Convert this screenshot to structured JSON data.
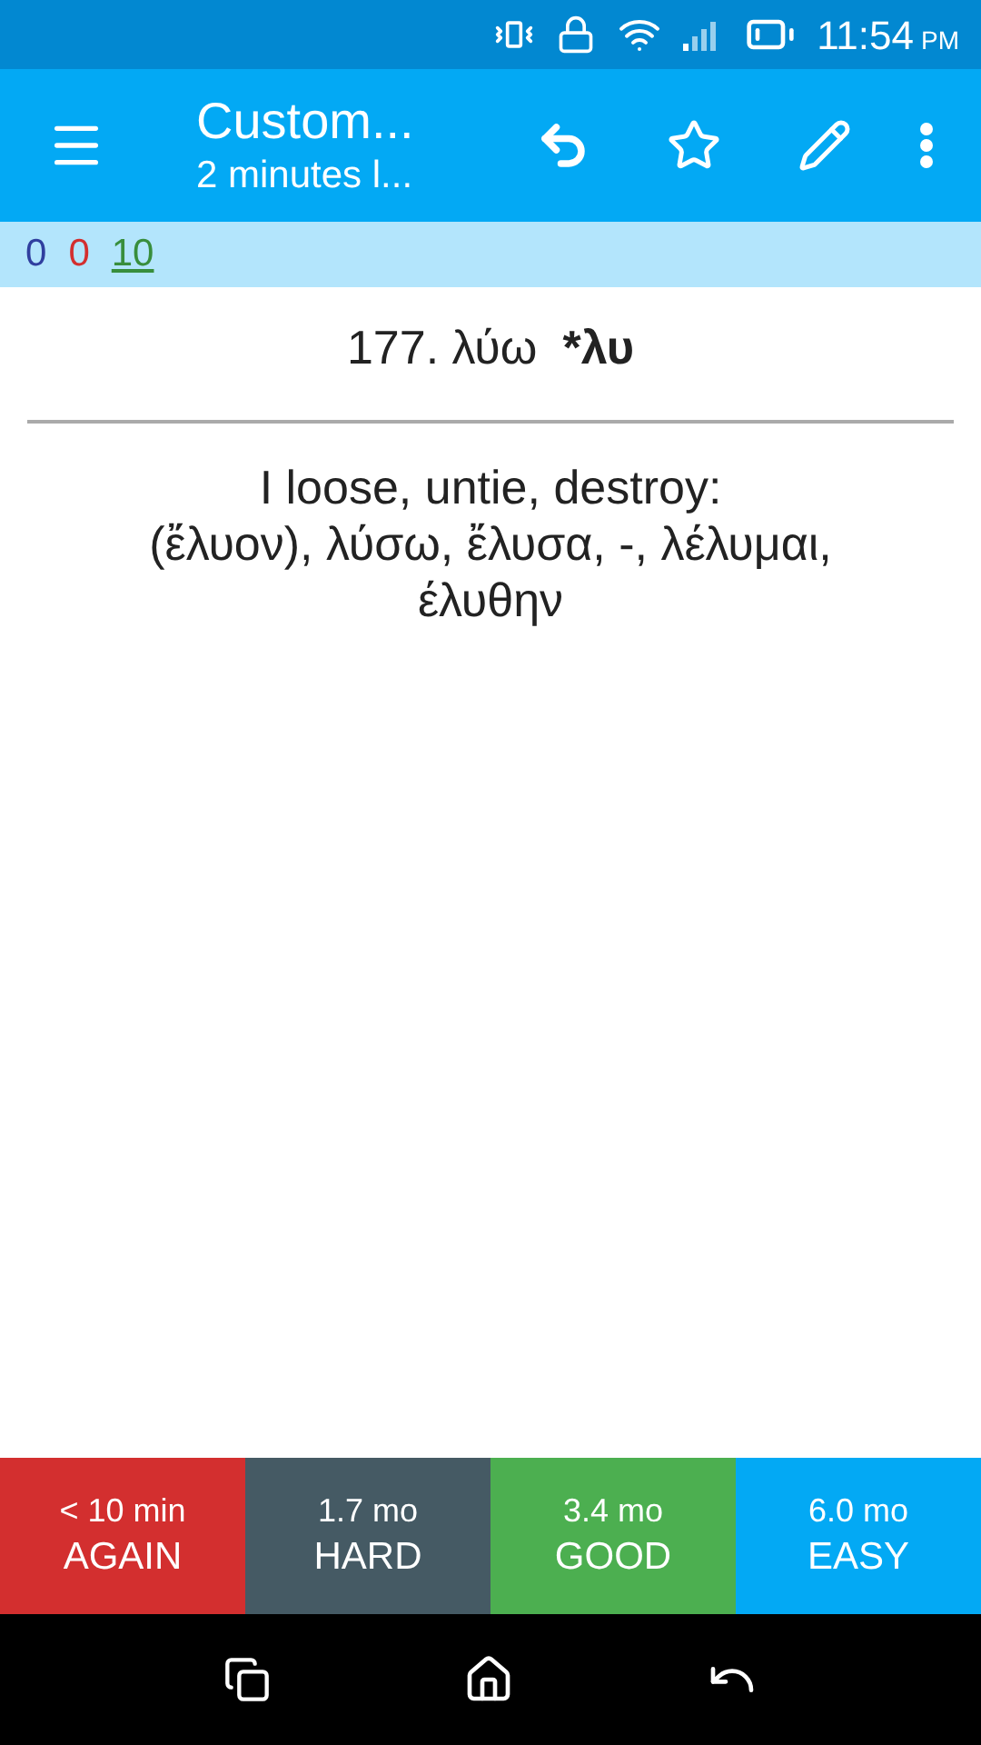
{
  "status_bar": {
    "time": "11:54",
    "ampm": "PM"
  },
  "toolbar": {
    "title": "Custom...",
    "subtitle": "2 minutes l..."
  },
  "counts": [
    {
      "value": "0",
      "color": "#303f9f",
      "selected": false
    },
    {
      "value": "0",
      "color": "#d32f2f",
      "selected": false
    },
    {
      "value": "10",
      "color": "#388e3c",
      "selected": true
    }
  ],
  "card": {
    "front": "177. λύω",
    "root": "*λυ",
    "answer_lines": [
      "I loose, untie, destroy:",
      "(ἔλυον), λύσω, ἔλυσα, -, λέλυμαι,",
      "έλυθην"
    ]
  },
  "answer_buttons": [
    {
      "interval": "< 10 min",
      "label": "AGAIN",
      "color": "#d32f2f"
    },
    {
      "interval": "1.7 mo",
      "label": "HARD",
      "color": "#455a64"
    },
    {
      "interval": "3.4 mo",
      "label": "GOOD",
      "color": "#4caf50"
    },
    {
      "interval": "6.0 mo",
      "label": "EASY",
      "color": "#03a9f4"
    }
  ]
}
